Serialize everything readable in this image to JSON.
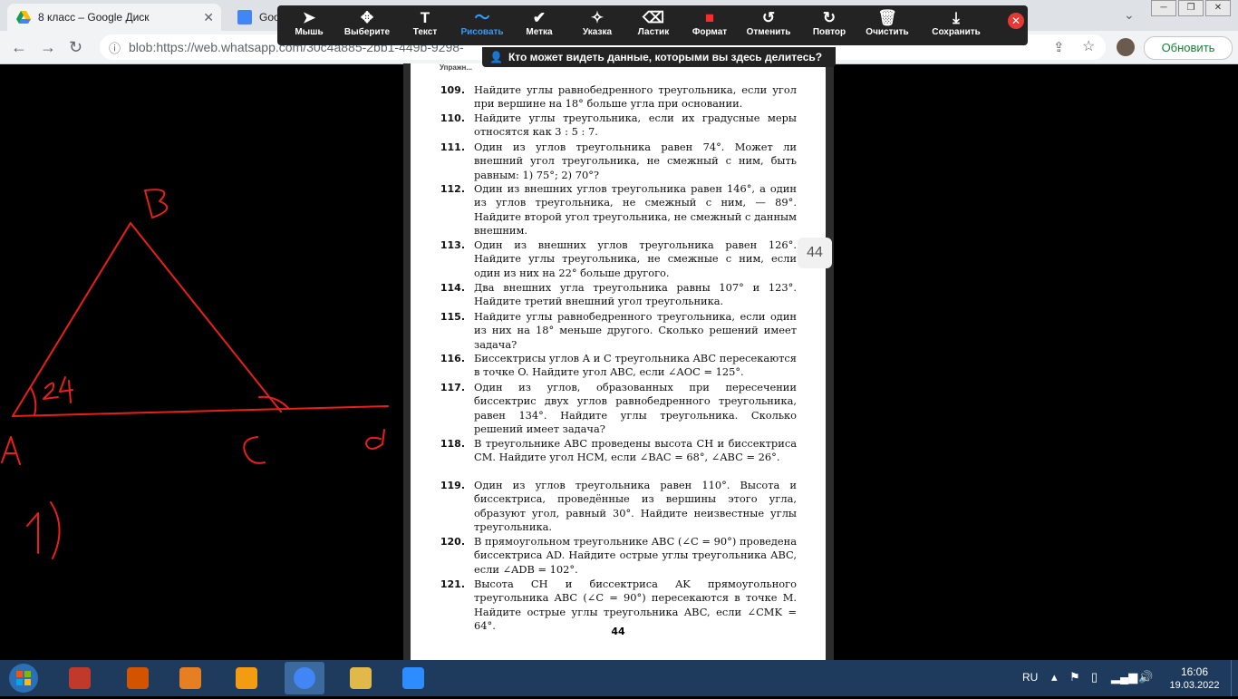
{
  "browser": {
    "tabs": [
      {
        "title": "8 класс – Google Диск"
      },
      {
        "title": "Goo"
      }
    ],
    "url": "blob:https://web.whatsapp.com/30c4a885-2bb1-449b-9298-",
    "update_label": "Обновить"
  },
  "annotation_toolbar": {
    "tools": [
      {
        "label": "Мышь",
        "icon": "cursor-icon"
      },
      {
        "label": "Выберите",
        "icon": "move-icon"
      },
      {
        "label": "Текст",
        "icon": "text-icon"
      },
      {
        "label": "Рисовать",
        "icon": "draw-icon",
        "active": true
      },
      {
        "label": "Метка",
        "icon": "checkmark-icon"
      },
      {
        "label": "Указка",
        "icon": "pointer-wand-icon"
      },
      {
        "label": "Ластик",
        "icon": "eraser-icon"
      },
      {
        "label": "Формат",
        "icon": "format-color-icon"
      },
      {
        "label": "Отменить",
        "icon": "undo-icon"
      },
      {
        "label": "Повтор",
        "icon": "redo-icon"
      },
      {
        "label": "Очистить",
        "icon": "trash-icon"
      },
      {
        "label": "Сохранить",
        "icon": "save-icon"
      }
    ],
    "share_notice": "Кто может видеть данные, которыми вы здесь делитесь?",
    "accent_color": "#2f9bff",
    "format_color": "#ff2a2a"
  },
  "textbook": {
    "section_stub": "Упражн...",
    "problems": [
      {
        "num": "109.",
        "text": "Найдите углы равнобедренного треугольника, если угол при вершине на 18° больше угла при основании."
      },
      {
        "num": "110.",
        "text": "Найдите углы треугольника, если их градусные меры относятся как 3 : 5 : 7."
      },
      {
        "num": "111.",
        "text": "Один из углов треугольника равен 74°. Может ли внешний угол треугольника, не смежный с ним, быть равным: 1) 75°; 2) 70°?"
      },
      {
        "num": "112.",
        "text": "Один из внешних углов треугольника равен 146°, а один из углов треугольника, не смежный с ним, — 89°. Найдите второй угол треугольника, не смежный с данным внешним."
      },
      {
        "num": "113.",
        "text": "Один из внешних углов треугольника равен 126°. Найдите углы треугольника, не смежные с ним, если один из них на 22° больше другого."
      },
      {
        "num": "114.",
        "text": "Два внешних угла треугольника равны 107° и 123°. Найдите третий внешний угол треугольника."
      },
      {
        "num": "115.",
        "text": "Найдите углы равнобедренного треугольника, если один из них на 18° меньше другого. Сколько решений имеет задача?"
      },
      {
        "num": "116.",
        "text": "Биссектрисы углов A и C треугольника ABC пересекаются в точке O. Найдите угол ABC, если ∠AOC = 125°."
      },
      {
        "num": "117.",
        "text": "Один из углов, образованных при пересечении биссектрис двух углов равнобедренного треугольника, равен 134°. Найдите углы треугольника. Сколько решений имеет задача?"
      },
      {
        "num": "118.",
        "text": "В треугольнике ABC проведены высота CH и биссектриса CM. Найдите угол HCM, если ∠BAC = 68°, ∠ABC = 26°."
      },
      {
        "num": "119.",
        "text": "Один из углов треугольника равен 110°. Высота и биссектриса, проведённые из вершины этого угла, образуют угол, равный 30°. Найдите неизвестные углы треугольника."
      },
      {
        "num": "120.",
        "text": "В прямоугольном треугольнике ABC (∠C = 90°) проведена биссектриса AD. Найдите острые углы треугольника ABC, если ∠ADB = 102°."
      },
      {
        "num": "121.",
        "text": "Высота CH и биссектриса AK прямоугольного треугольника ABC (∠C = 90°) пересекаются в точке M. Найдите острые углы треугольника ABC, если ∠CMK = 64°."
      }
    ],
    "page_number": "44",
    "page_badge": "44"
  },
  "drawing": {
    "color": "#e8201c",
    "labels": {
      "B": "B",
      "A": "A",
      "C": "C",
      "angle": "24",
      "end": "d",
      "item": "1)"
    }
  },
  "taskbar": {
    "language": "RU",
    "time": "16:06",
    "date": "19.03.2022",
    "apps": [
      "start-orb-icon",
      "app-red-gear-icon",
      "ccleaner-icon",
      "video-player-icon",
      "avast-icon",
      "chrome-icon",
      "file-explorer-icon",
      "zoom-icon"
    ]
  }
}
